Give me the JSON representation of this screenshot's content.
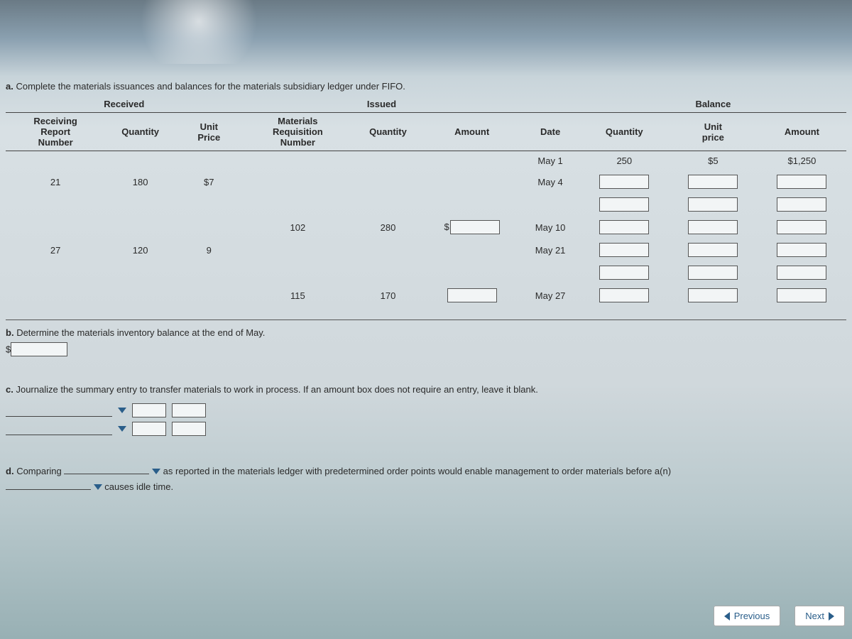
{
  "a": {
    "prompt_label": "a.",
    "prompt": "Complete the materials issuances and balances for the materials subsidiary ledger under FIFO.",
    "sections": {
      "received": "Received",
      "issued": "Issued",
      "balance": "Balance"
    },
    "headers": {
      "recv_report": "Receiving Report Number",
      "recv_qty": "Quantity",
      "recv_price": "Unit Price",
      "req_no": "Materials Requisition Number",
      "iss_qty": "Quantity",
      "iss_amt": "Amount",
      "date": "Date",
      "bal_qty": "Quantity",
      "bal_price": "Unit price",
      "bal_amt": "Amount"
    },
    "rows": [
      {
        "recv_report": "",
        "recv_qty": "",
        "recv_price": "",
        "req_no": "",
        "iss_qty": "",
        "iss_amt_prefix": "",
        "iss_amt_input": false,
        "date": "May 1",
        "bal_qty": "250",
        "bal_qty_input": false,
        "bal_price": "$5",
        "bal_price_input": false,
        "bal_amt": "$1,250",
        "bal_amt_input": false
      },
      {
        "recv_report": "21",
        "recv_qty": "180",
        "recv_price": "$7",
        "req_no": "",
        "iss_qty": "",
        "iss_amt_prefix": "",
        "iss_amt_input": false,
        "date": "May 4",
        "bal_qty": "",
        "bal_qty_input": true,
        "bal_price": "",
        "bal_price_input": true,
        "bal_amt": "",
        "bal_amt_input": true
      },
      {
        "recv_report": "",
        "recv_qty": "",
        "recv_price": "",
        "req_no": "",
        "iss_qty": "",
        "iss_amt_prefix": "",
        "iss_amt_input": false,
        "date": "",
        "bal_qty": "",
        "bal_qty_input": true,
        "bal_price": "",
        "bal_price_input": true,
        "bal_amt": "",
        "bal_amt_input": true
      },
      {
        "recv_report": "",
        "recv_qty": "",
        "recv_price": "",
        "req_no": "102",
        "iss_qty": "280",
        "iss_amt_prefix": "$",
        "iss_amt_input": true,
        "date": "May 10",
        "bal_qty": "",
        "bal_qty_input": true,
        "bal_price": "",
        "bal_price_input": true,
        "bal_amt": "",
        "bal_amt_input": true
      },
      {
        "recv_report": "27",
        "recv_qty": "120",
        "recv_price": "9",
        "req_no": "",
        "iss_qty": "",
        "iss_amt_prefix": "",
        "iss_amt_input": false,
        "date": "May 21",
        "bal_qty": "",
        "bal_qty_input": true,
        "bal_price": "",
        "bal_price_input": true,
        "bal_amt": "",
        "bal_amt_input": true
      },
      {
        "recv_report": "",
        "recv_qty": "",
        "recv_price": "",
        "req_no": "",
        "iss_qty": "",
        "iss_amt_prefix": "",
        "iss_amt_input": false,
        "date": "",
        "bal_qty": "",
        "bal_qty_input": true,
        "bal_price": "",
        "bal_price_input": true,
        "bal_amt": "",
        "bal_amt_input": true
      },
      {
        "recv_report": "",
        "recv_qty": "",
        "recv_price": "",
        "req_no": "115",
        "iss_qty": "170",
        "iss_amt_prefix": "",
        "iss_amt_input": true,
        "date": "May 27",
        "bal_qty": "",
        "bal_qty_input": true,
        "bal_price": "",
        "bal_price_input": true,
        "bal_amt": "",
        "bal_amt_input": true
      }
    ]
  },
  "b": {
    "prompt_label": "b.",
    "prompt": "Determine the materials inventory balance at the end of May.",
    "prefix": "$"
  },
  "c": {
    "prompt_label": "c.",
    "prompt": "Journalize the summary entry to transfer materials to work in process. If an amount box does not require an entry, leave it blank."
  },
  "d": {
    "prompt_label": "d.",
    "text1": "Comparing",
    "text2": "as reported in the materials ledger with predetermined order points would enable management to order materials before a(n)",
    "text3": "causes idle time."
  },
  "nav": {
    "prev": "Previous",
    "next": "Next"
  }
}
